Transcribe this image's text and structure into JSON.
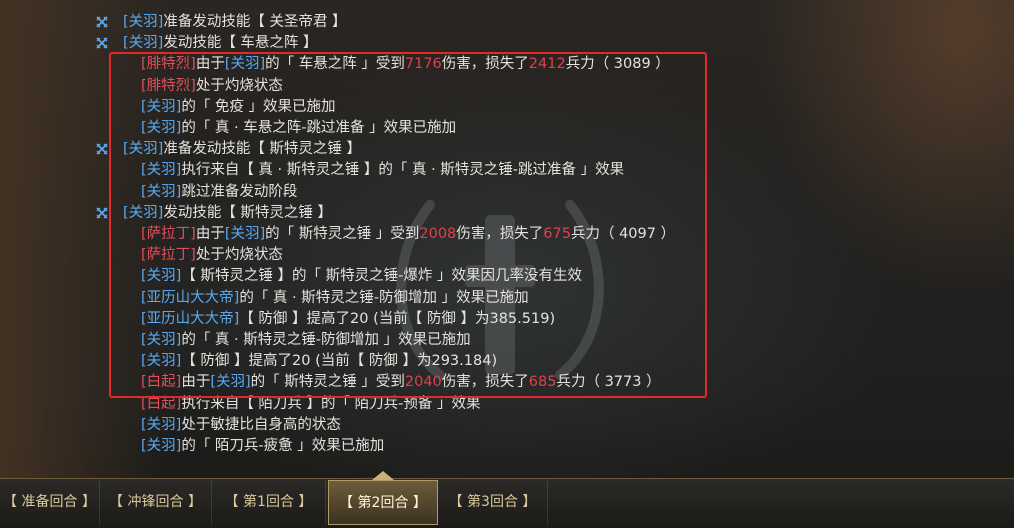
{
  "colors": {
    "hero": "#5aa9f0",
    "enemy": "#e0505a",
    "damage": "#e0404a",
    "text": "#e4e2dc",
    "highlight_border": "#e02a2a",
    "tab_text": "#d8c89a"
  },
  "icons": {
    "action": "crossed-swords-icon"
  },
  "log": [
    {
      "icon": true,
      "hero": "[关羽]",
      "t1": "准备发动技能【 关圣帝君 】"
    },
    {
      "icon": true,
      "hero": "[关羽]",
      "t1": "发动技能【 车悬之阵 】"
    },
    {
      "enemy": "[腓特烈]",
      "t1": "由于",
      "hero2": "[关羽]",
      "t2": "的「 车悬之阵 」受到",
      "n1": "7176",
      "t3": "伤害，损失了",
      "n2": "2412",
      "t4": "兵力（ 3089 ）"
    },
    {
      "enemy": "[腓特烈]",
      "t1": "处于灼烧状态"
    },
    {
      "hero": "[关羽]",
      "t1": "的「 免疫 」效果已施加"
    },
    {
      "hero": "[关羽]",
      "t1": "的「 真 · 车悬之阵-跳过准备 」效果已施加"
    },
    {
      "icon": true,
      "hero": "[关羽]",
      "t1": "准备发动技能【 斯特灵之锤 】"
    },
    {
      "hero": "[关羽]",
      "t1": "执行来自【 真 · 斯特灵之锤 】的「 真 · 斯特灵之锤-跳过准备 」效果"
    },
    {
      "hero": "[关羽]",
      "t1": "跳过准备发动阶段"
    },
    {
      "icon": true,
      "hero": "[关羽]",
      "t1": "发动技能【 斯特灵之锤 】"
    },
    {
      "enemy": "[萨拉丁]",
      "t1": "由于",
      "hero2": "[关羽]",
      "t2": "的「 斯特灵之锤 」受到",
      "n1": "2008",
      "t3": "伤害，损失了",
      "n2": "675",
      "t4": "兵力（ 4097 ）"
    },
    {
      "enemy": "[萨拉丁]",
      "t1": "处于灼烧状态"
    },
    {
      "hero": "[关羽]",
      "t1": "【 斯特灵之锤 】的「 斯特灵之锤-爆炸 」效果因几率没有生效"
    },
    {
      "hero": "[亚历山大大帝]",
      "t1": "的「 真 · 斯特灵之锤-防御增加 」效果已施加"
    },
    {
      "hero": "[亚历山大大帝]",
      "t1": "【 防御 】提高了20 (当前【 防御 】为385.519)"
    },
    {
      "hero": "[关羽]",
      "t1": "的「 真 · 斯特灵之锤-防御增加 」效果已施加"
    },
    {
      "hero": "[关羽]",
      "t1": "【 防御 】提高了20 (当前【 防御 】为293.184)"
    },
    {
      "enemy": "[白起]",
      "t1": "由于",
      "hero2": "[关羽]",
      "t2": "的「 斯特灵之锤 」受到",
      "n1": "2040",
      "t3": "伤害，损失了",
      "n2": "685",
      "t4": "兵力（ 3773 ）"
    },
    {
      "enemy": "[白起]",
      "t1": "执行来自【 陌刀兵 】的「 陌刀兵-预备 」效果"
    },
    {
      "hero": "[关羽]",
      "t1": "处于敏捷比自身高的状态"
    },
    {
      "hero": "[关羽]",
      "t1": "的「 陌刀兵-疲惫 」效果已施加"
    }
  ],
  "tabs": [
    "【 准备回合 】",
    "【 冲锋回合 】",
    "【 第1回合 】",
    "【 第2回合 】",
    "【 第3回合 】"
  ],
  "active_tab": "【 第2回合 】"
}
